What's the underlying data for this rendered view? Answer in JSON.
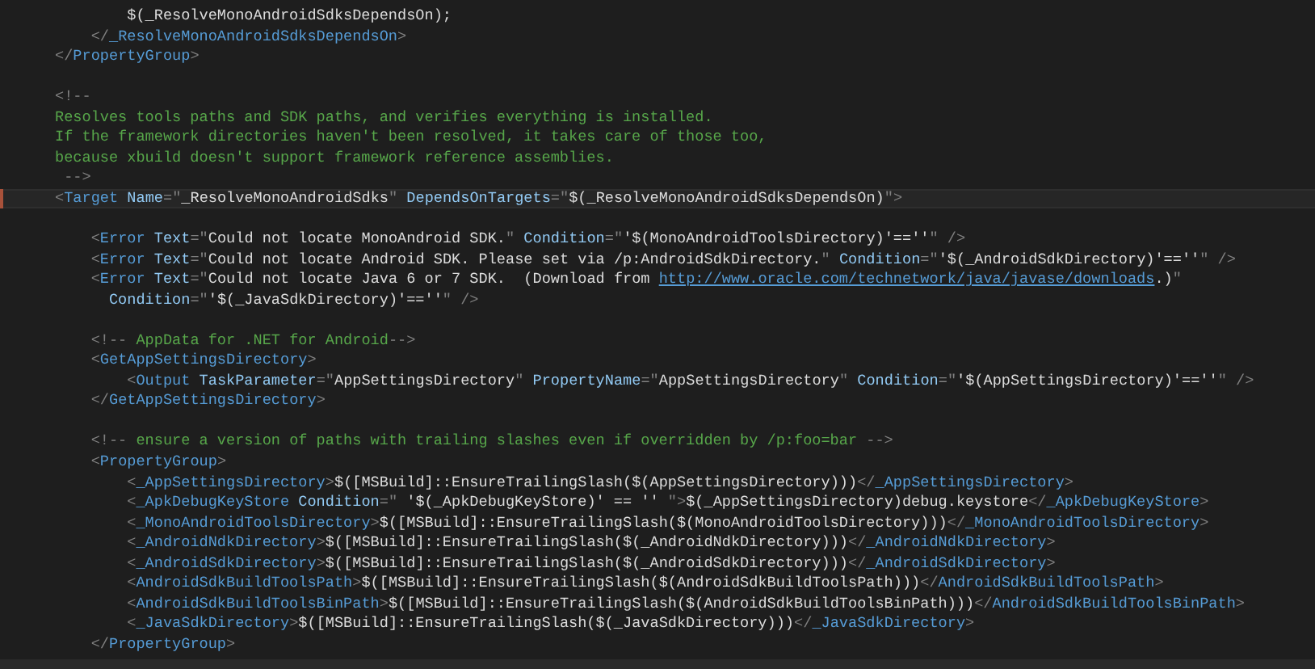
{
  "editor": {
    "lines": [
      {
        "kind": "code",
        "current": false,
        "segments": [
          {
            "kind": "text",
            "text": "        $(_ResolveMonoAndroidSdksDependsOn);"
          }
        ]
      },
      {
        "kind": "code",
        "current": false,
        "segments": [
          {
            "kind": "punct",
            "text": "    </"
          },
          {
            "kind": "tag",
            "text": "_ResolveMonoAndroidSdksDependsOn"
          },
          {
            "kind": "punct",
            "text": ">"
          }
        ]
      },
      {
        "kind": "code",
        "current": false,
        "segments": [
          {
            "kind": "punct",
            "text": "</"
          },
          {
            "kind": "tag",
            "text": "PropertyGroup"
          },
          {
            "kind": "punct",
            "text": ">"
          }
        ]
      },
      {
        "kind": "blank",
        "current": false
      },
      {
        "kind": "code",
        "current": false,
        "segments": [
          {
            "kind": "punct",
            "text": "<!--"
          }
        ]
      },
      {
        "kind": "code",
        "current": false,
        "segments": [
          {
            "kind": "comment",
            "text": "Resolves tools paths and SDK paths, and verifies everything is installed."
          }
        ]
      },
      {
        "kind": "code",
        "current": false,
        "segments": [
          {
            "kind": "comment",
            "text": "If the framework directories haven't been resolved, it takes care of those too,"
          }
        ]
      },
      {
        "kind": "code",
        "current": false,
        "segments": [
          {
            "kind": "comment",
            "text": "because xbuild doesn't support framework reference assemblies."
          }
        ]
      },
      {
        "kind": "code",
        "current": false,
        "segments": [
          {
            "kind": "punct",
            "text": " -->"
          }
        ]
      },
      {
        "kind": "code",
        "current": true,
        "segments": [
          {
            "kind": "punct",
            "text": "<"
          },
          {
            "kind": "tag",
            "text": "Target"
          },
          {
            "kind": "attr",
            "text": " Name"
          },
          {
            "kind": "punct",
            "text": "=\""
          },
          {
            "kind": "text",
            "text": "_ResolveMonoAndroidSdks"
          },
          {
            "kind": "punct",
            "text": "\""
          },
          {
            "kind": "attr",
            "text": " DependsOnTargets"
          },
          {
            "kind": "punct",
            "text": "=\""
          },
          {
            "kind": "text",
            "text": "$(_ResolveMonoAndroidSdksDependsOn)"
          },
          {
            "kind": "punct",
            "text": "\">"
          }
        ]
      },
      {
        "kind": "blank",
        "current": false
      },
      {
        "kind": "code",
        "current": false,
        "segments": [
          {
            "kind": "punct",
            "text": "    <"
          },
          {
            "kind": "tag",
            "text": "Error"
          },
          {
            "kind": "attr",
            "text": " Text"
          },
          {
            "kind": "punct",
            "text": "=\""
          },
          {
            "kind": "text",
            "text": "Could not locate MonoAndroid SDK."
          },
          {
            "kind": "punct",
            "text": "\""
          },
          {
            "kind": "attr",
            "text": " Condition"
          },
          {
            "kind": "punct",
            "text": "=\""
          },
          {
            "kind": "text",
            "text": "'$(MonoAndroidToolsDirectory)'==''"
          },
          {
            "kind": "punct",
            "text": "\" />"
          }
        ]
      },
      {
        "kind": "code",
        "current": false,
        "segments": [
          {
            "kind": "punct",
            "text": "    <"
          },
          {
            "kind": "tag",
            "text": "Error"
          },
          {
            "kind": "attr",
            "text": " Text"
          },
          {
            "kind": "punct",
            "text": "=\""
          },
          {
            "kind": "text",
            "text": "Could not locate Android SDK. Please set via /p:AndroidSdkDirectory."
          },
          {
            "kind": "punct",
            "text": "\""
          },
          {
            "kind": "attr",
            "text": " Condition"
          },
          {
            "kind": "punct",
            "text": "=\""
          },
          {
            "kind": "text",
            "text": "'$(_AndroidSdkDirectory)'==''"
          },
          {
            "kind": "punct",
            "text": "\" />"
          }
        ]
      },
      {
        "kind": "code",
        "current": false,
        "segments": [
          {
            "kind": "punct",
            "text": "    <"
          },
          {
            "kind": "tag",
            "text": "Error"
          },
          {
            "kind": "attr",
            "text": " Text"
          },
          {
            "kind": "punct",
            "text": "=\""
          },
          {
            "kind": "text",
            "text": "Could not locate Java 6 or 7 SDK.  (Download from "
          },
          {
            "kind": "link",
            "text": "http://www.oracle.com/technetwork/java/javase/downloads"
          },
          {
            "kind": "text",
            "text": ".)"
          },
          {
            "kind": "punct",
            "text": "\""
          }
        ]
      },
      {
        "kind": "code",
        "current": false,
        "segments": [
          {
            "kind": "attr",
            "text": "      Condition"
          },
          {
            "kind": "punct",
            "text": "=\""
          },
          {
            "kind": "text",
            "text": "'$(_JavaSdkDirectory)'==''"
          },
          {
            "kind": "punct",
            "text": "\" />"
          }
        ]
      },
      {
        "kind": "blank",
        "current": false
      },
      {
        "kind": "code",
        "current": false,
        "segments": [
          {
            "kind": "punct",
            "text": "    <!--"
          },
          {
            "kind": "comment",
            "text": " AppData for .NET for Android"
          },
          {
            "kind": "punct",
            "text": "-->"
          }
        ]
      },
      {
        "kind": "code",
        "current": false,
        "segments": [
          {
            "kind": "punct",
            "text": "    <"
          },
          {
            "kind": "tag",
            "text": "GetAppSettingsDirectory"
          },
          {
            "kind": "punct",
            "text": ">"
          }
        ]
      },
      {
        "kind": "code",
        "current": false,
        "segments": [
          {
            "kind": "punct",
            "text": "        <"
          },
          {
            "kind": "tag",
            "text": "Output"
          },
          {
            "kind": "attr",
            "text": " TaskParameter"
          },
          {
            "kind": "punct",
            "text": "=\""
          },
          {
            "kind": "text",
            "text": "AppSettingsDirectory"
          },
          {
            "kind": "punct",
            "text": "\""
          },
          {
            "kind": "attr",
            "text": " PropertyName"
          },
          {
            "kind": "punct",
            "text": "=\""
          },
          {
            "kind": "text",
            "text": "AppSettingsDirectory"
          },
          {
            "kind": "punct",
            "text": "\""
          },
          {
            "kind": "attr",
            "text": " Condition"
          },
          {
            "kind": "punct",
            "text": "=\""
          },
          {
            "kind": "text",
            "text": "'$(AppSettingsDirectory)'==''"
          },
          {
            "kind": "punct",
            "text": "\" />"
          }
        ]
      },
      {
        "kind": "code",
        "current": false,
        "segments": [
          {
            "kind": "punct",
            "text": "    </"
          },
          {
            "kind": "tag",
            "text": "GetAppSettingsDirectory"
          },
          {
            "kind": "punct",
            "text": ">"
          }
        ]
      },
      {
        "kind": "blank",
        "current": false
      },
      {
        "kind": "code",
        "current": false,
        "segments": [
          {
            "kind": "punct",
            "text": "    <!--"
          },
          {
            "kind": "comment",
            "text": " ensure a version of paths with trailing slashes even if overridden by /p:foo=bar "
          },
          {
            "kind": "punct",
            "text": "-->"
          }
        ]
      },
      {
        "kind": "code",
        "current": false,
        "segments": [
          {
            "kind": "punct",
            "text": "    <"
          },
          {
            "kind": "tag",
            "text": "PropertyGroup"
          },
          {
            "kind": "punct",
            "text": ">"
          }
        ]
      },
      {
        "kind": "code",
        "current": false,
        "segments": [
          {
            "kind": "punct",
            "text": "        <"
          },
          {
            "kind": "tag",
            "text": "_AppSettingsDirectory"
          },
          {
            "kind": "punct",
            "text": ">"
          },
          {
            "kind": "text",
            "text": "$([MSBuild]::EnsureTrailingSlash($(AppSettingsDirectory)))"
          },
          {
            "kind": "punct",
            "text": "</"
          },
          {
            "kind": "tag",
            "text": "_AppSettingsDirectory"
          },
          {
            "kind": "punct",
            "text": ">"
          }
        ]
      },
      {
        "kind": "code",
        "current": false,
        "segments": [
          {
            "kind": "punct",
            "text": "        <"
          },
          {
            "kind": "tag",
            "text": "_ApkDebugKeyStore"
          },
          {
            "kind": "attr",
            "text": " Condition"
          },
          {
            "kind": "punct",
            "text": "=\""
          },
          {
            "kind": "text",
            "text": " '$(_ApkDebugKeyStore)' == '' "
          },
          {
            "kind": "punct",
            "text": "\">"
          },
          {
            "kind": "text",
            "text": "$(_AppSettingsDirectory)debug.keystore"
          },
          {
            "kind": "punct",
            "text": "</"
          },
          {
            "kind": "tag",
            "text": "_ApkDebugKeyStore"
          },
          {
            "kind": "punct",
            "text": ">"
          }
        ]
      },
      {
        "kind": "code",
        "current": false,
        "segments": [
          {
            "kind": "punct",
            "text": "        <"
          },
          {
            "kind": "tag",
            "text": "_MonoAndroidToolsDirectory"
          },
          {
            "kind": "punct",
            "text": ">"
          },
          {
            "kind": "text",
            "text": "$([MSBuild]::EnsureTrailingSlash($(MonoAndroidToolsDirectory)))"
          },
          {
            "kind": "punct",
            "text": "</"
          },
          {
            "kind": "tag",
            "text": "_MonoAndroidToolsDirectory"
          },
          {
            "kind": "punct",
            "text": ">"
          }
        ]
      },
      {
        "kind": "code",
        "current": false,
        "segments": [
          {
            "kind": "punct",
            "text": "        <"
          },
          {
            "kind": "tag",
            "text": "_AndroidNdkDirectory"
          },
          {
            "kind": "punct",
            "text": ">"
          },
          {
            "kind": "text",
            "text": "$([MSBuild]::EnsureTrailingSlash($(_AndroidNdkDirectory)))"
          },
          {
            "kind": "punct",
            "text": "</"
          },
          {
            "kind": "tag",
            "text": "_AndroidNdkDirectory"
          },
          {
            "kind": "punct",
            "text": ">"
          }
        ]
      },
      {
        "kind": "code",
        "current": false,
        "segments": [
          {
            "kind": "punct",
            "text": "        <"
          },
          {
            "kind": "tag",
            "text": "_AndroidSdkDirectory"
          },
          {
            "kind": "punct",
            "text": ">"
          },
          {
            "kind": "text",
            "text": "$([MSBuild]::EnsureTrailingSlash($(_AndroidSdkDirectory)))"
          },
          {
            "kind": "punct",
            "text": "</"
          },
          {
            "kind": "tag",
            "text": "_AndroidSdkDirectory"
          },
          {
            "kind": "punct",
            "text": ">"
          }
        ]
      },
      {
        "kind": "code",
        "current": false,
        "segments": [
          {
            "kind": "punct",
            "text": "        <"
          },
          {
            "kind": "tag",
            "text": "AndroidSdkBuildToolsPath"
          },
          {
            "kind": "punct",
            "text": ">"
          },
          {
            "kind": "text",
            "text": "$([MSBuild]::EnsureTrailingSlash($(AndroidSdkBuildToolsPath)))"
          },
          {
            "kind": "punct",
            "text": "</"
          },
          {
            "kind": "tag",
            "text": "AndroidSdkBuildToolsPath"
          },
          {
            "kind": "punct",
            "text": ">"
          }
        ]
      },
      {
        "kind": "code",
        "current": false,
        "segments": [
          {
            "kind": "punct",
            "text": "        <"
          },
          {
            "kind": "tag",
            "text": "AndroidSdkBuildToolsBinPath"
          },
          {
            "kind": "punct",
            "text": ">"
          },
          {
            "kind": "text",
            "text": "$([MSBuild]::EnsureTrailingSlash($(AndroidSdkBuildToolsBinPath)))"
          },
          {
            "kind": "punct",
            "text": "</"
          },
          {
            "kind": "tag",
            "text": "AndroidSdkBuildToolsBinPath"
          },
          {
            "kind": "punct",
            "text": ">"
          }
        ]
      },
      {
        "kind": "code",
        "current": false,
        "segments": [
          {
            "kind": "punct",
            "text": "        <"
          },
          {
            "kind": "tag",
            "text": "_JavaSdkDirectory"
          },
          {
            "kind": "punct",
            "text": ">"
          },
          {
            "kind": "text",
            "text": "$([MSBuild]::EnsureTrailingSlash($(_JavaSdkDirectory)))"
          },
          {
            "kind": "punct",
            "text": "</"
          },
          {
            "kind": "tag",
            "text": "_JavaSdkDirectory"
          },
          {
            "kind": "punct",
            "text": ">"
          }
        ]
      },
      {
        "kind": "code",
        "current": false,
        "segments": [
          {
            "kind": "punct",
            "text": "    </"
          },
          {
            "kind": "tag",
            "text": "PropertyGroup"
          },
          {
            "kind": "punct",
            "text": ">"
          }
        ]
      }
    ]
  }
}
